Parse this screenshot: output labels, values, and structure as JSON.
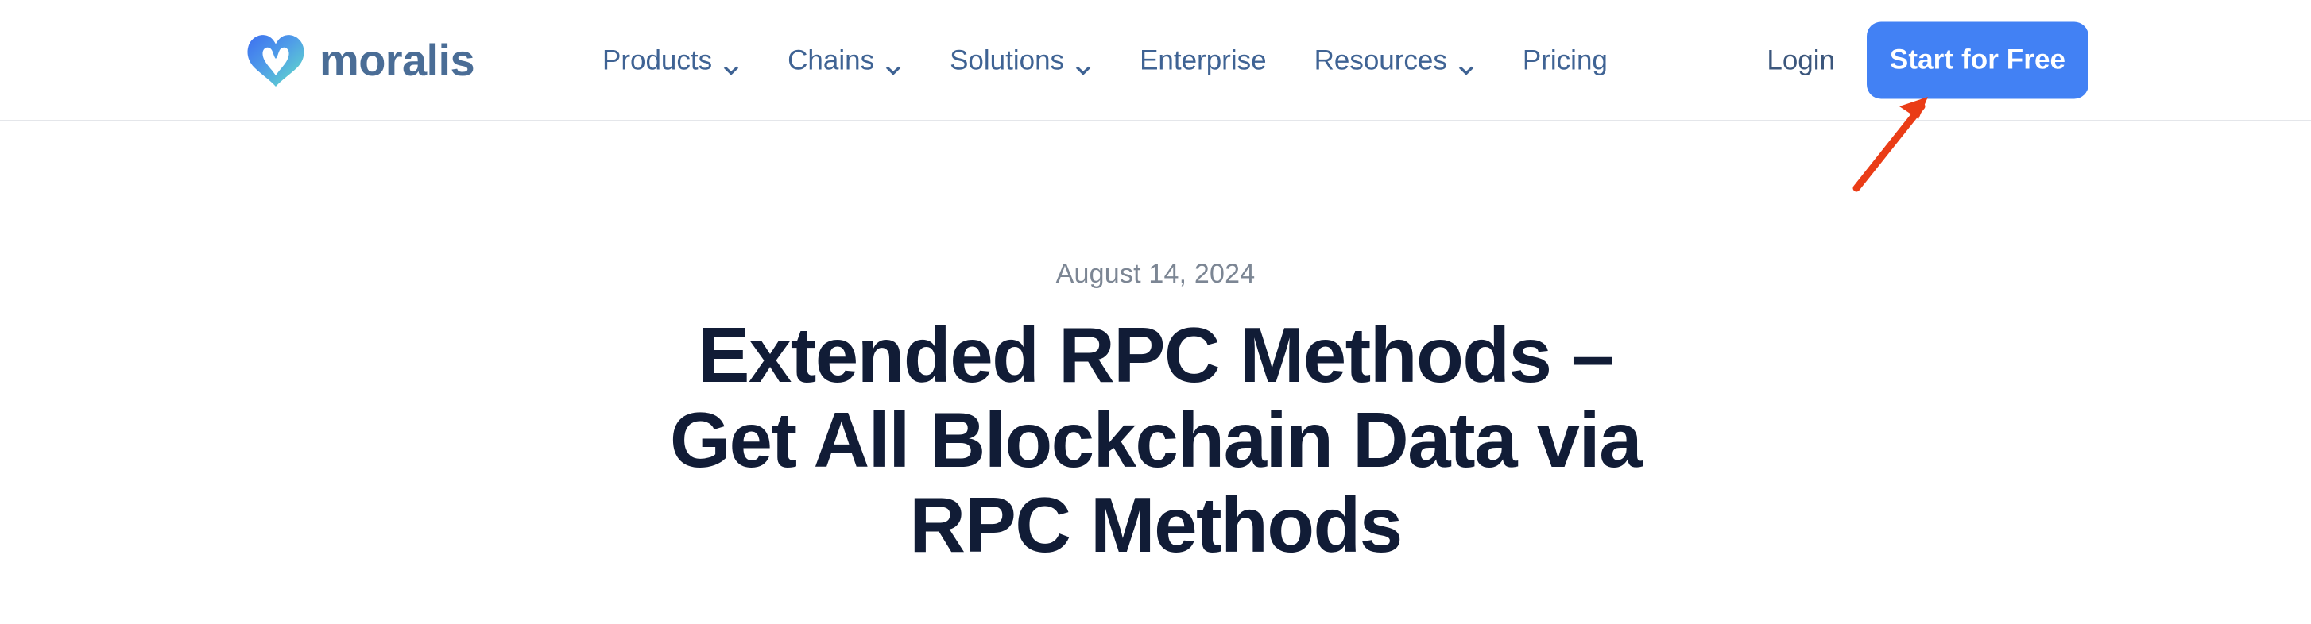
{
  "site": {
    "brand_name": "moralis",
    "logo_gradient_from": "#3d7df0",
    "logo_gradient_to": "#64e3c6",
    "wordmark_color": "#4a6d96"
  },
  "header": {
    "nav_items": [
      {
        "label": "Products",
        "has_dropdown": true,
        "icon": "chevron-down-icon"
      },
      {
        "label": "Chains",
        "has_dropdown": true,
        "icon": "chevron-down-icon"
      },
      {
        "label": "Solutions",
        "has_dropdown": true,
        "icon": "chevron-down-icon"
      },
      {
        "label": "Enterprise",
        "has_dropdown": false,
        "icon": ""
      },
      {
        "label": "Resources",
        "has_dropdown": true,
        "icon": "chevron-down-icon"
      },
      {
        "label": "Pricing",
        "has_dropdown": false,
        "icon": ""
      }
    ],
    "login_label": "Login",
    "cta_label": "Start for Free",
    "cta_color": "#4281f4",
    "nav_text_color": "#3f6394",
    "border_color": "#e4e6ea"
  },
  "annotation": {
    "type": "arrow",
    "color": "#ea3c16",
    "points_to": "cta-button",
    "direction": "up-right"
  },
  "hero": {
    "date": "August 14, 2024",
    "date_color": "#7c8694",
    "title_color": "#111c36",
    "title_lines": [
      "Extended RPC Methods –",
      "Get All Blockchain Data via",
      "RPC Methods"
    ],
    "title_full": "Extended RPC Methods – Get All Blockchain Data via RPC Methods"
  }
}
